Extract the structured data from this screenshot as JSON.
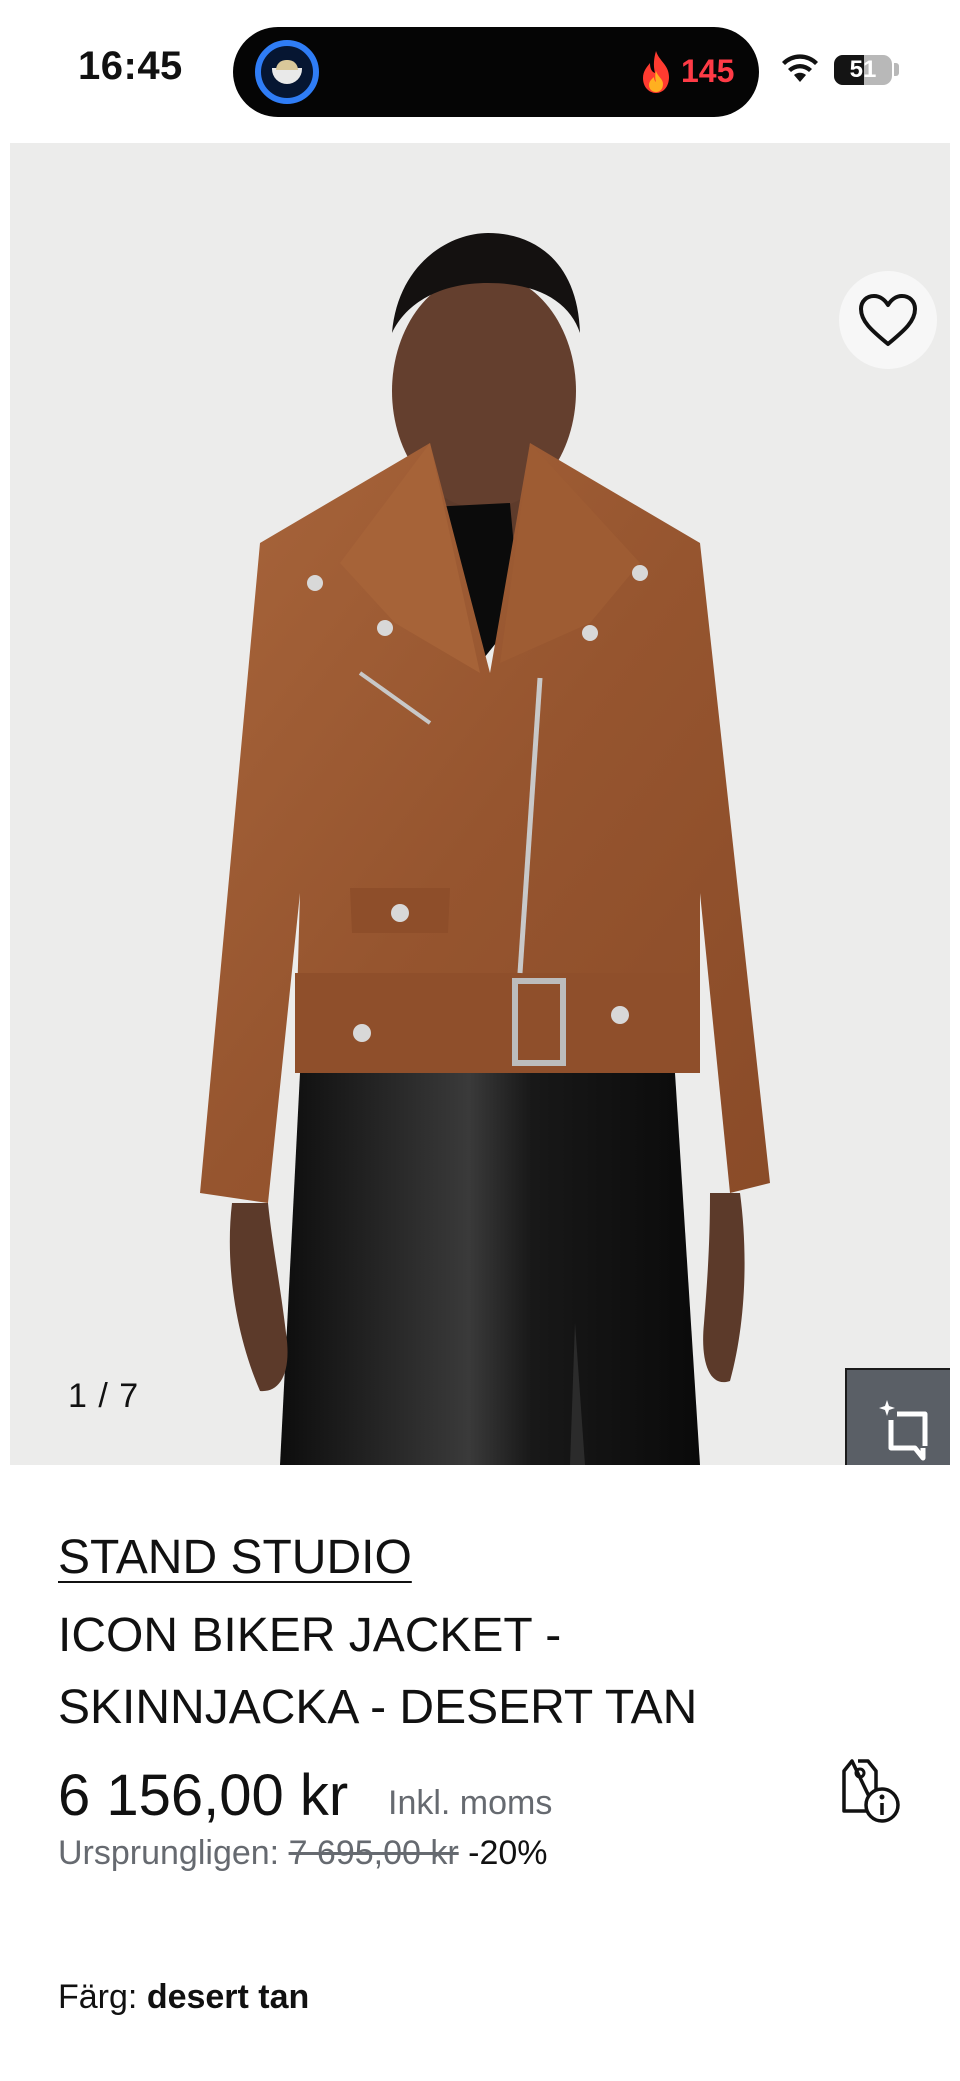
{
  "status_bar": {
    "time": "16:45",
    "live_activity_count": "145",
    "battery_level": "51",
    "battery_fraction": 0.51,
    "icons": [
      "app-bowl-icon",
      "flame-icon",
      "wifi-icon",
      "battery-icon"
    ]
  },
  "gallery": {
    "counter": "1 / 7",
    "current_index": 1,
    "total": 7,
    "favorite_icon": "heart-outline-icon",
    "crop_icon": "sparkle-crop-icon"
  },
  "product": {
    "brand": "STAND STUDIO",
    "title": "ICON BIKER JACKET - SKINNJACKA - DESERT TAN",
    "price": "6 156,00 kr",
    "tax_note": "Inkl. moms",
    "original_label": "Ursprungligen:",
    "original_price": "7 695,00 kr",
    "discount": "-20%",
    "price_info_icon": "price-tag-info-icon",
    "color_label": "Färg:",
    "color_value": "desert tan"
  },
  "colors": {
    "jacket": "#9b5a33",
    "skirt": "#161616",
    "background": "#ececeb",
    "accent_red": "#ff3b46",
    "muted_text": "#666a70"
  }
}
